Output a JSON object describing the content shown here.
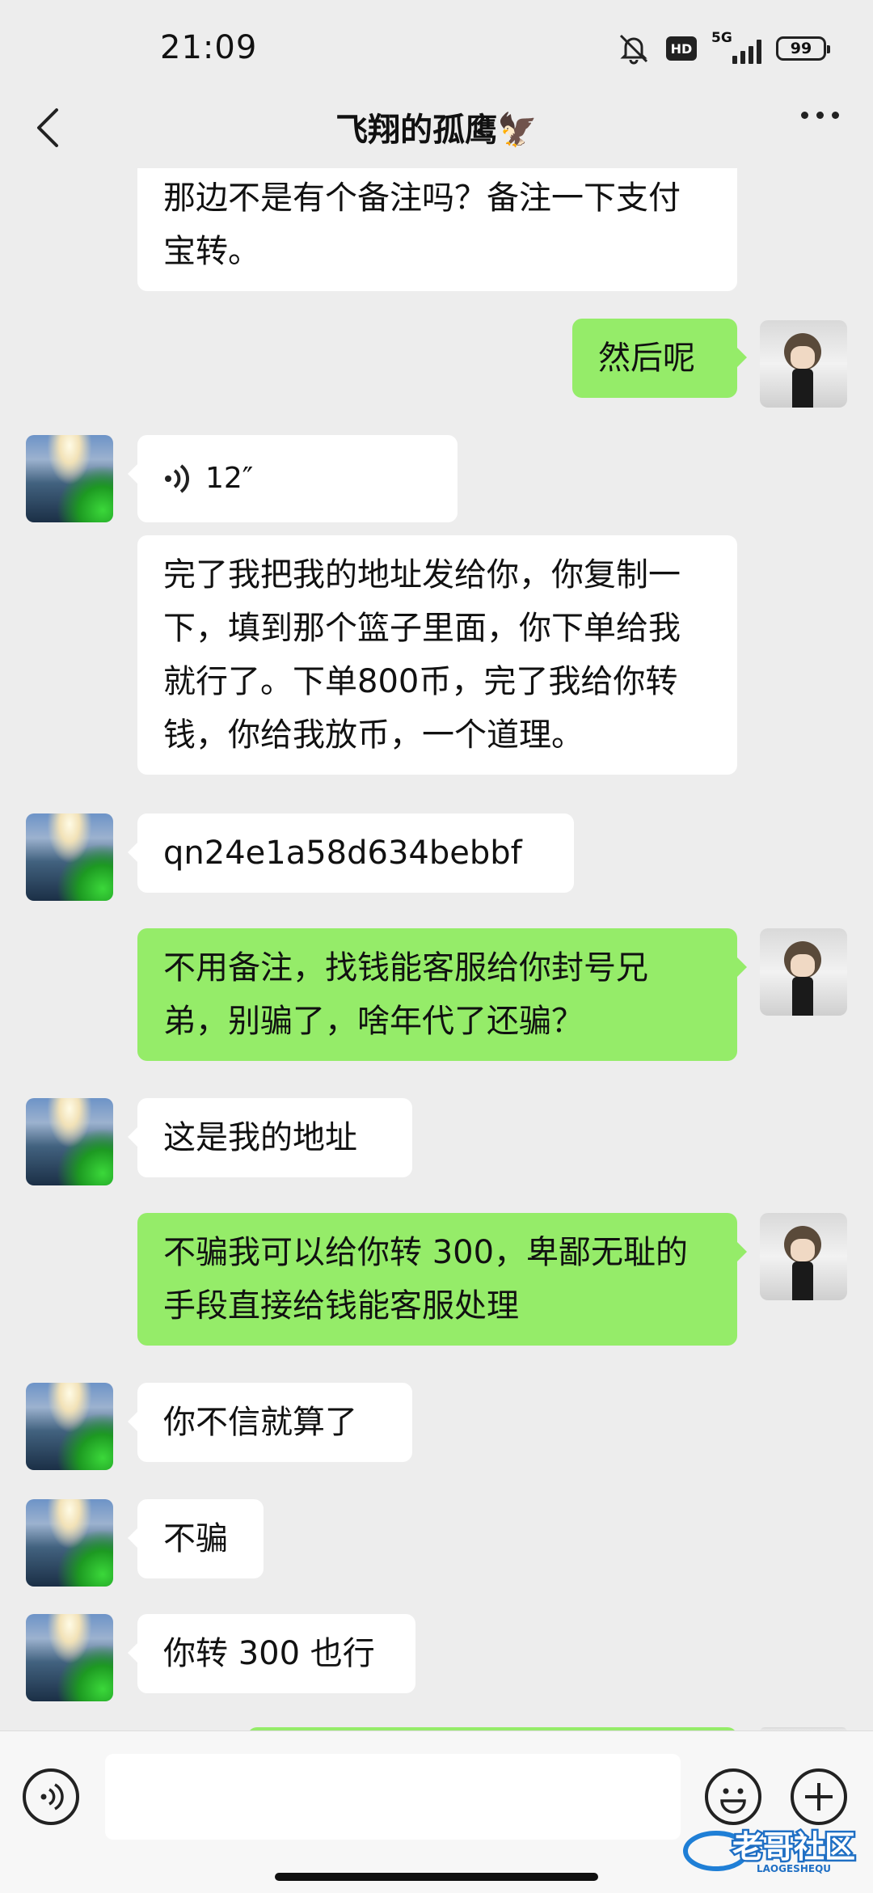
{
  "status": {
    "time": "21:09",
    "hd": "HD",
    "network": "5G",
    "battery": "99"
  },
  "header": {
    "title": "飞翔的孤鹰🦅"
  },
  "messages": [
    {
      "side": "in",
      "type": "text",
      "text": "那边不是有个备注吗？备注一下支付宝转。"
    },
    {
      "side": "out",
      "type": "text",
      "text": "然后呢"
    },
    {
      "side": "in",
      "type": "voice",
      "duration": "12″"
    },
    {
      "side": "in",
      "type": "text",
      "text": "完了我把我的地址发给你，你复制一下，填到那个篮子里面，你下单给我就行了。下单800币，完了我给你转钱，你给我放币，一个道理。"
    },
    {
      "side": "in",
      "type": "text",
      "text": "qn24e1a58d634bebbf"
    },
    {
      "side": "out",
      "type": "text",
      "text": "不用备注，找钱能客服给你封号兄弟，别骗了，啥年代了还骗？"
    },
    {
      "side": "in",
      "type": "text",
      "text": "这是我的地址"
    },
    {
      "side": "out",
      "type": "text",
      "text": "不骗我可以给你转 300，卑鄙无耻的手段直接给钱能客服处理"
    },
    {
      "side": "in",
      "type": "text",
      "text": "你不信就算了"
    },
    {
      "side": "in",
      "type": "text",
      "text": "不骗"
    },
    {
      "side": "in",
      "type": "text",
      "text": "你转 300 也行"
    }
  ],
  "input": {
    "placeholder": ""
  },
  "watermark": {
    "text": "老哥社区",
    "subtext": "LAOGESHEQU"
  },
  "colors": {
    "background": "#ededed",
    "incoming": "#ffffff",
    "outgoing": "#95ec69"
  },
  "icons": [
    "back-arrow-icon",
    "more-icon",
    "voice-mode-icon",
    "emoji-icon",
    "plus-icon"
  ]
}
